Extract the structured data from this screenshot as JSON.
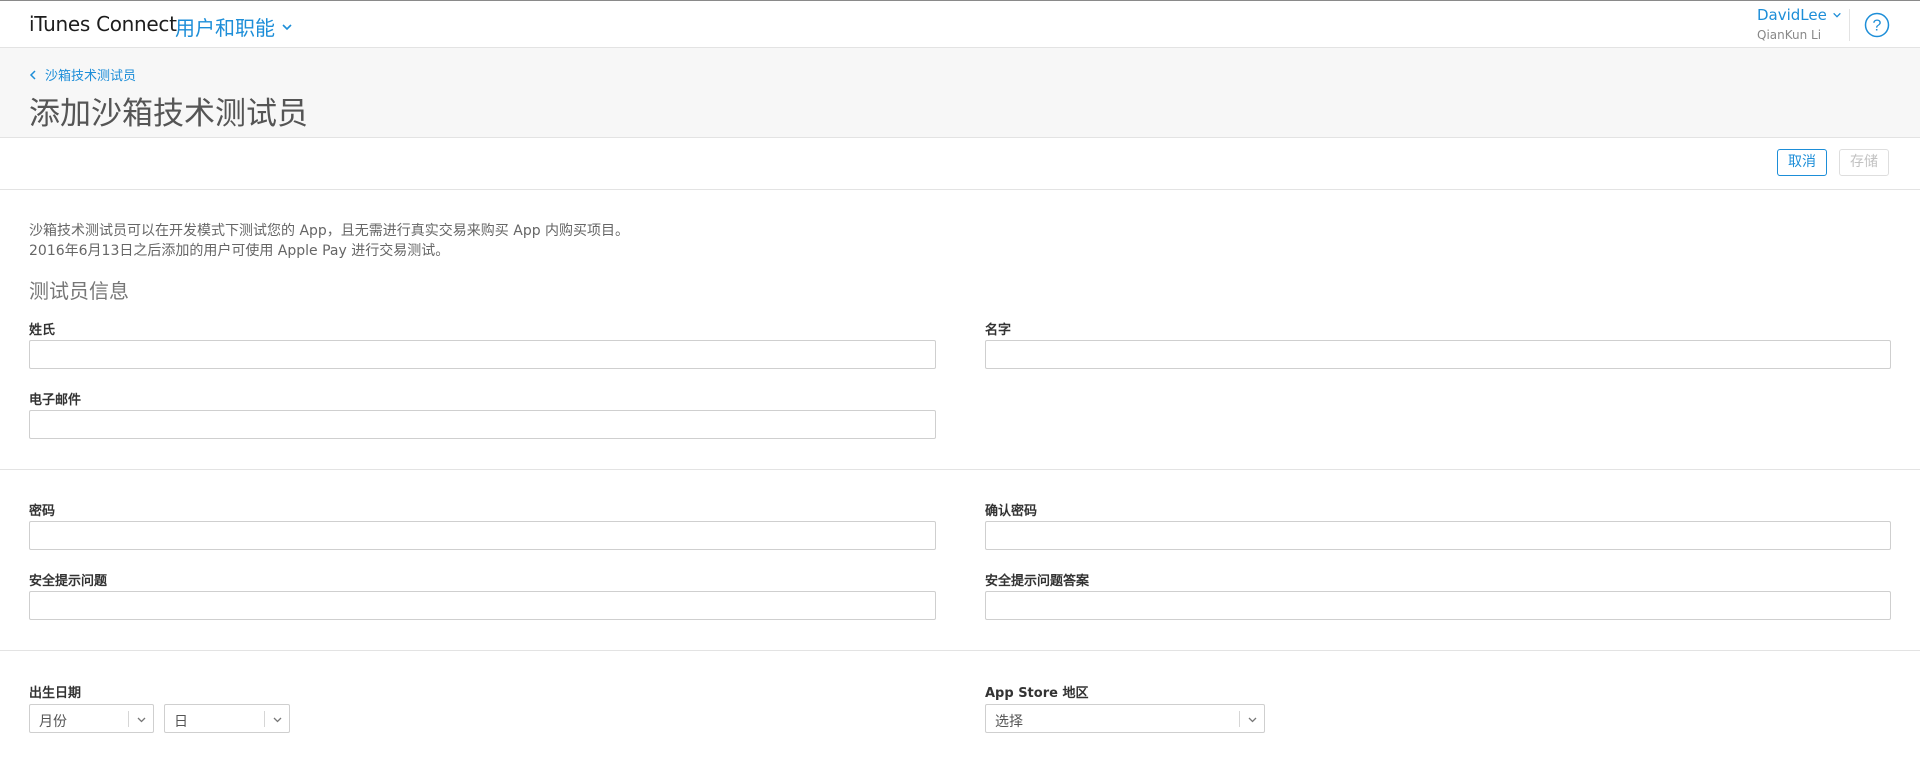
{
  "nav": {
    "brand": "iTunes Connect",
    "section": "用户和职能",
    "user_name": "DavidLee",
    "user_sub": "QianKun Li"
  },
  "header": {
    "breadcrumb": "沙箱技术测试员",
    "title": "添加沙箱技术测试员"
  },
  "toolbar": {
    "cancel_label": "取消",
    "save_label": "存储"
  },
  "intro": {
    "line1": "沙箱技术测试员可以在开发模式下测试您的 App，且无需进行真实交易来购买 App 内购买项目。",
    "line2": "2016年6月13日之后添加的用户可使用 Apple Pay 进行交易测试。"
  },
  "form": {
    "section_heading": "测试员信息",
    "last_name_label": "姓氏",
    "first_name_label": "名字",
    "email_label": "电子邮件",
    "password_label": "密码",
    "confirm_password_label": "确认密码",
    "security_question_label": "安全提示问题",
    "security_answer_label": "安全提示问题答案",
    "birthdate_label": "出生日期",
    "month_value": "月份",
    "day_value": "日",
    "storefront_label": "App Store 地区",
    "storefront_value": "选择"
  },
  "colors": {
    "accent": "#1d8ed8",
    "border": "#e3e3e3",
    "header_bg": "#f7f7f7"
  },
  "icons": {
    "section_menu": "chevron-down-icon",
    "user_menu": "chevron-down-icon",
    "help": "help-circle-icon",
    "breadcrumb": "chevron-left-icon",
    "select": "chevron-down-icon"
  }
}
